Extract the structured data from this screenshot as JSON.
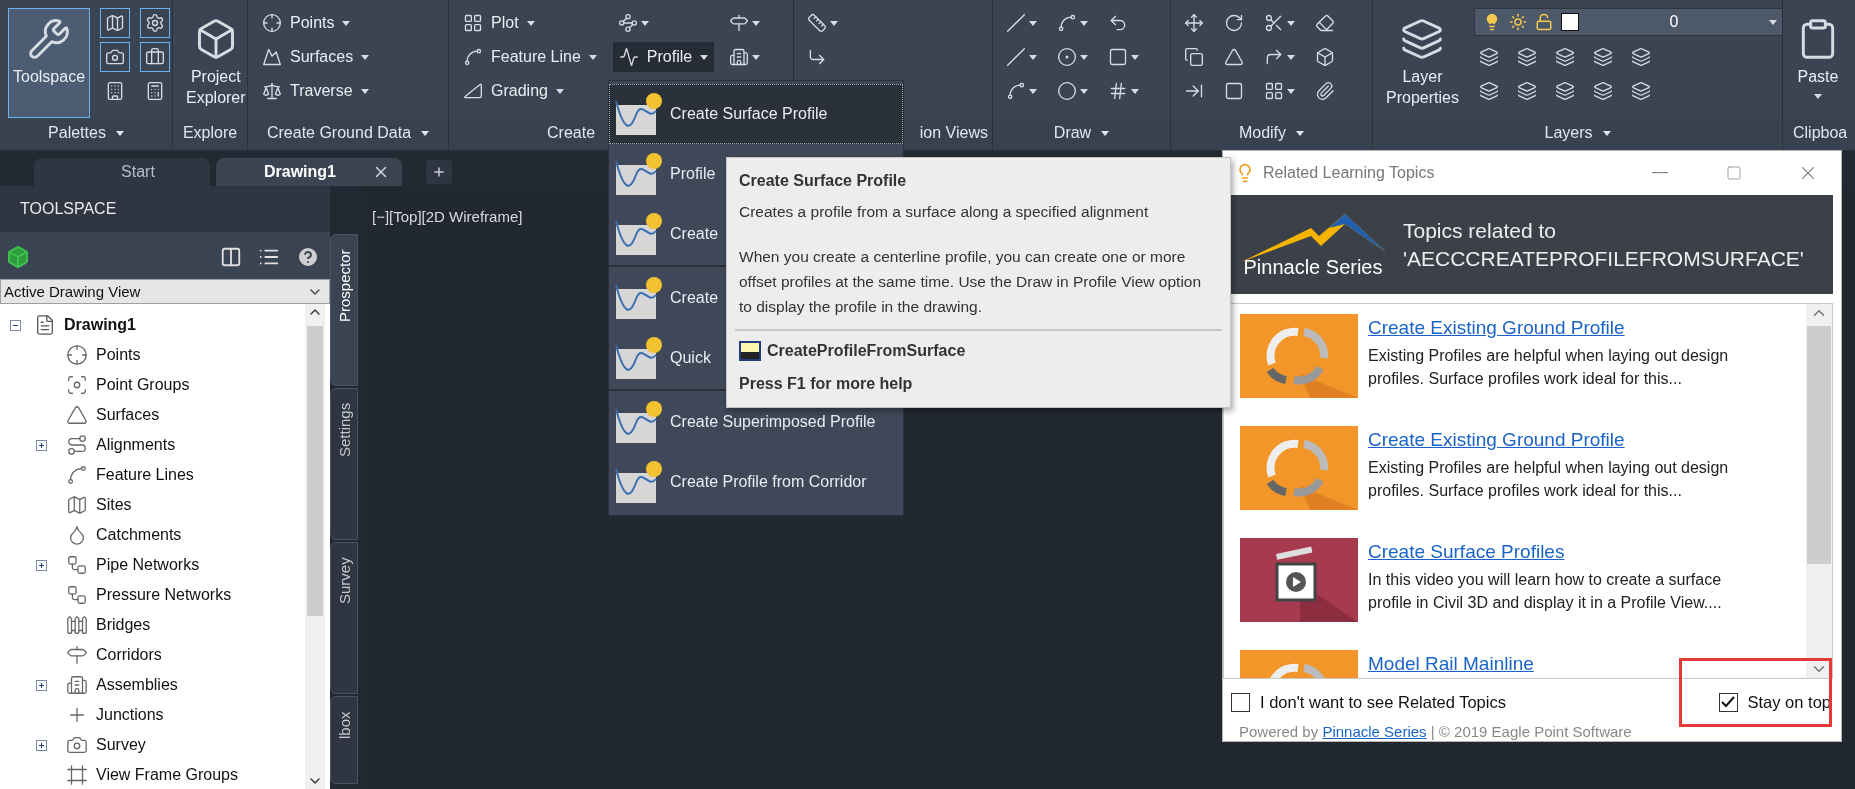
{
  "ribbon": {
    "panels": [
      {
        "label": "Palettes",
        "menu": true,
        "columns": [
          [
            {
              "kind": "large",
              "label": "Toolspace",
              "on": true
            }
          ],
          [
            {
              "kind": "icon",
              "on": true
            },
            {
              "kind": "icon",
              "on": true
            },
            {
              "kind": "icon",
              "on": false
            }
          ],
          [
            {
              "kind": "icon",
              "on": true
            },
            {
              "kind": "icon",
              "on": true
            },
            {
              "kind": "icon",
              "on": false
            }
          ]
        ]
      },
      {
        "label": "Explore",
        "menu": false,
        "columns": [
          [
            {
              "kind": "large",
              "label": "Project Explorer"
            }
          ]
        ]
      },
      {
        "label": "Create Ground Data",
        "menu": true,
        "columns": [
          [
            {
              "kind": "small",
              "label": "Points",
              "dropdown": true
            },
            {
              "kind": "small",
              "label": "Surfaces",
              "dropdown": true
            },
            {
              "kind": "small",
              "label": "Traverse",
              "dropdown": true
            }
          ]
        ]
      },
      {
        "label": "Create",
        "menu": false,
        "columns": [
          [
            {
              "kind": "small",
              "label": "Plot",
              "dropdown": true
            },
            {
              "kind": "small",
              "label": "Feature Line",
              "dropdown": true
            },
            {
              "kind": "small",
              "label": "Grading",
              "dropdown": true
            }
          ],
          [
            {
              "kind": "icon",
              "dropdown": true
            },
            {
              "kind": "small",
              "label": "Profile",
              "dropdown": true,
              "open": true
            }
          ],
          [
            {
              "kind": "icon",
              "dropdown": true
            },
            {
              "kind": "icon",
              "dropdown": true
            }
          ]
        ]
      },
      {
        "label": "ion Views",
        "menu": false,
        "columns": [
          [
            {
              "kind": "icon",
              "dropdown": true
            },
            {
              "kind": "icon",
              "dropdown": false
            }
          ]
        ]
      },
      {
        "label": "Draw",
        "menu": true,
        "columns": [
          [
            {
              "kind": "icon",
              "dropdown": true
            },
            {
              "kind": "icon",
              "dropdown": true
            },
            {
              "kind": "icon",
              "dropdown": true
            }
          ],
          [
            {
              "kind": "icon",
              "dropdown": true
            },
            {
              "kind": "icon",
              "dropdown": true
            },
            {
              "kind": "icon",
              "dropdown": true
            }
          ],
          [
            {
              "kind": "icon",
              "dropdown": false
            },
            {
              "kind": "icon",
              "dropdown": true
            },
            {
              "kind": "icon",
              "dropdown": true
            }
          ]
        ]
      },
      {
        "label": "Modify",
        "menu": true,
        "columns": [
          [
            {
              "kind": "icon",
              "dropdown": false
            },
            {
              "kind": "icon",
              "dropdown": false
            },
            {
              "kind": "icon",
              "dropdown": false
            }
          ],
          [
            {
              "kind": "icon",
              "dropdown": false
            },
            {
              "kind": "icon",
              "dropdown": false
            },
            {
              "kind": "icon",
              "dropdown": false
            }
          ],
          [
            {
              "kind": "icon",
              "dropdown": true
            },
            {
              "kind": "icon",
              "dropdown": true
            },
            {
              "kind": "icon",
              "dropdown": true
            }
          ],
          [
            {
              "kind": "icon",
              "dropdown": false
            },
            {
              "kind": "icon",
              "dropdown": false
            },
            {
              "kind": "icon",
              "dropdown": false
            }
          ]
        ]
      },
      {
        "label": "Layers",
        "menu": true,
        "columns": [
          [
            {
              "kind": "large",
              "label": "Layer Properties"
            }
          ]
        ],
        "combo": {
          "value": "0"
        },
        "grid": [
          [
            {
              "kind": "icon"
            },
            {
              "kind": "icon"
            }
          ],
          [
            {
              "kind": "icon"
            },
            {
              "kind": "icon"
            }
          ],
          [
            {
              "kind": "icon"
            },
            {
              "kind": "icon"
            }
          ],
          [
            {
              "kind": "icon"
            },
            {
              "kind": "icon"
            }
          ],
          [
            {
              "kind": "icon"
            },
            {
              "kind": "icon"
            }
          ]
        ]
      },
      {
        "label": "Clipboa",
        "menu": false,
        "columns": [
          [
            {
              "kind": "large",
              "label": "Paste",
              "dropdown": true
            }
          ]
        ]
      }
    ]
  },
  "tabs": [
    {
      "label": "Start",
      "selected": false,
      "closable": false
    },
    {
      "label": "Drawing1",
      "selected": true,
      "closable": true
    }
  ],
  "toolspace": {
    "title": "TOOLSPACE",
    "view": "Active Drawing View",
    "tree": [
      {
        "label": "Drawing1",
        "kind": "branch",
        "expanded": true,
        "children": [
          {
            "label": "Points",
            "kind": "leaf"
          },
          {
            "label": "Point Groups",
            "kind": "leaf"
          },
          {
            "label": "Surfaces",
            "kind": "leaf"
          },
          {
            "label": "Alignments",
            "kind": "branch",
            "expanded": false
          },
          {
            "label": "Feature Lines",
            "kind": "leaf"
          },
          {
            "label": "Sites",
            "kind": "leaf"
          },
          {
            "label": "Catchments",
            "kind": "leaf"
          },
          {
            "label": "Pipe Networks",
            "kind": "branch",
            "expanded": false
          },
          {
            "label": "Pressure Networks",
            "kind": "leaf"
          },
          {
            "label": "Bridges",
            "kind": "leaf"
          },
          {
            "label": "Corridors",
            "kind": "leaf"
          },
          {
            "label": "Assemblies",
            "kind": "branch",
            "expanded": false
          },
          {
            "label": "Junctions",
            "kind": "leaf"
          },
          {
            "label": "Survey",
            "kind": "branch",
            "expanded": false
          },
          {
            "label": "View Frame Groups",
            "kind": "leaf"
          }
        ]
      }
    ]
  },
  "side_tabs": [
    {
      "label": "Prospector",
      "selected": true
    },
    {
      "label": "Settings",
      "selected": false
    },
    {
      "label": "Survey",
      "selected": false
    },
    {
      "label": "lbox",
      "selected": false
    }
  ],
  "viewport": {
    "label": "[−][Top][2D Wireframe]"
  },
  "menu": {
    "groups": [
      [
        {
          "label": "Create Surface Profile",
          "selected": true
        },
        {
          "label": "Profile",
          "selected": false
        },
        {
          "label": "Create",
          "selected": false
        }
      ],
      [
        {
          "label": "Create",
          "selected": false
        },
        {
          "label": "Quick",
          "selected": false
        }
      ],
      [
        {
          "label": "Create Superimposed Profile",
          "selected": false
        },
        {
          "label": "Create Profile from Corridor",
          "selected": false
        }
      ]
    ]
  },
  "tooltip": {
    "title": "Create Surface Profile",
    "description": "Creates a profile from a surface along a specified alignment",
    "details": "When you create a centerline profile, you can create one or more offset profiles at the same time. Use the Draw in Profile View option to display the profile in the drawing.",
    "command": "CreateProfileFromSurface",
    "help": "Press F1 for more help"
  },
  "dialog": {
    "title": "Related Learning Topics",
    "logo": "Pinnacle Series",
    "heading": "Topics related to",
    "topic": "'AECCCREATEPROFILEFROMSURFACE'",
    "topics": [
      {
        "kind": "article",
        "title": "Create Existing Ground Profile",
        "summary": "Existing Profiles are helpful when laying out design profiles.  Surface profiles work ideal for this..."
      },
      {
        "kind": "article",
        "title": "Create Existing Ground Profile",
        "summary": "Existing Profiles are helpful when laying out design profiles.  Surface profiles work ideal for this..."
      },
      {
        "kind": "video",
        "title": "Create Surface Profiles",
        "summary": "In this video you will learn how to create a surface profile in Civil 3D and display it in a Profile View...."
      },
      {
        "kind": "article",
        "title": "Model Rail Mainline"
      }
    ],
    "hide_option": {
      "label": "I don't want to see Related Topics",
      "checked": false
    },
    "stay_on_top": {
      "label": "Stay on top",
      "checked": true,
      "highlighted": true
    },
    "footer": {
      "prefix": "Powered by",
      "link": "Pinnacle Series",
      "suffix": "| © 2019 Eagle Point Software"
    }
  }
}
